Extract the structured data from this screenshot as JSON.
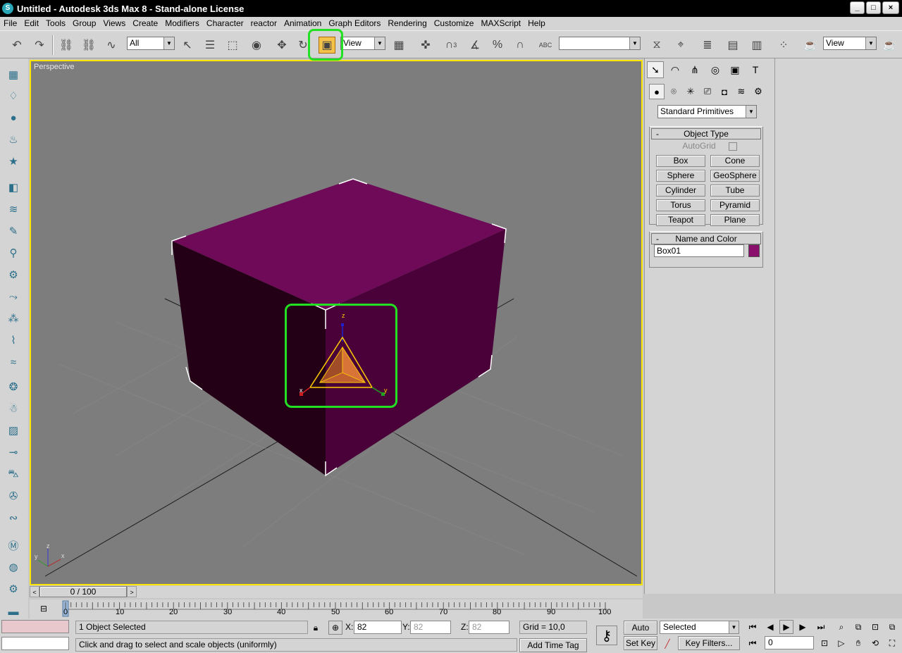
{
  "window": {
    "title": "Untitled - Autodesk 3ds Max 8  - Stand-alone License",
    "app_icon_glyph": "S",
    "minimize_glyph": "_",
    "maximize_glyph": "□",
    "close_glyph": "×"
  },
  "menu": [
    "File",
    "Edit",
    "Tools",
    "Group",
    "Views",
    "Create",
    "Modifiers",
    "Character",
    "reactor",
    "Animation",
    "Graph Editors",
    "Rendering",
    "Customize",
    "MAXScript",
    "Help"
  ],
  "toolbar": {
    "selection_filter": "All",
    "reference_coord": "View",
    "named_selection": "",
    "view_dropdown": "View",
    "snap_angle_label": "3",
    "abc_label": "ABC",
    "highlighted_tool": "select-and-uniform-scale-icon"
  },
  "viewport": {
    "label": "Perspective",
    "box_color": "#6e0a58",
    "gizmo_axes": {
      "z": "z",
      "x": "x",
      "y": "y"
    },
    "corner_axes": {
      "z": "z",
      "y": "y",
      "x": "x"
    }
  },
  "command_panel": {
    "category_dropdown": "Standard Primitives",
    "object_type": {
      "title": "Object Type",
      "collapse": "-",
      "autogrid": "AutoGrid",
      "buttons": [
        "Box",
        "Cone",
        "Sphere",
        "GeoSphere",
        "Cylinder",
        "Tube",
        "Torus",
        "Pyramid",
        "Teapot",
        "Plane"
      ]
    },
    "name_and_color": {
      "title": "Name and Color",
      "collapse": "-",
      "name": "Box01",
      "color": "#8a0f6c"
    }
  },
  "time_slider": {
    "position": "0 / 100",
    "prev_glyph": "<",
    "next_glyph": ">"
  },
  "trackbar": {
    "ticks": [
      "0",
      "10",
      "20",
      "30",
      "40",
      "50",
      "60",
      "70",
      "80",
      "90",
      "100"
    ]
  },
  "status": {
    "selection": "1 Object Selected",
    "prompt": "Click and drag to select and scale objects (uniformly)",
    "x_label": "X:",
    "x_value": "82",
    "y_label": "Y:",
    "y_value": "82",
    "z_label": "Z:",
    "z_value": "82",
    "grid": "Grid = 10,0",
    "add_time_tag": "Add Time Tag",
    "auto_key": "Auto Key",
    "set_key": "Set Key",
    "key_mode": "Selected",
    "key_filters": "Key Filters...",
    "current_frame": "0"
  }
}
